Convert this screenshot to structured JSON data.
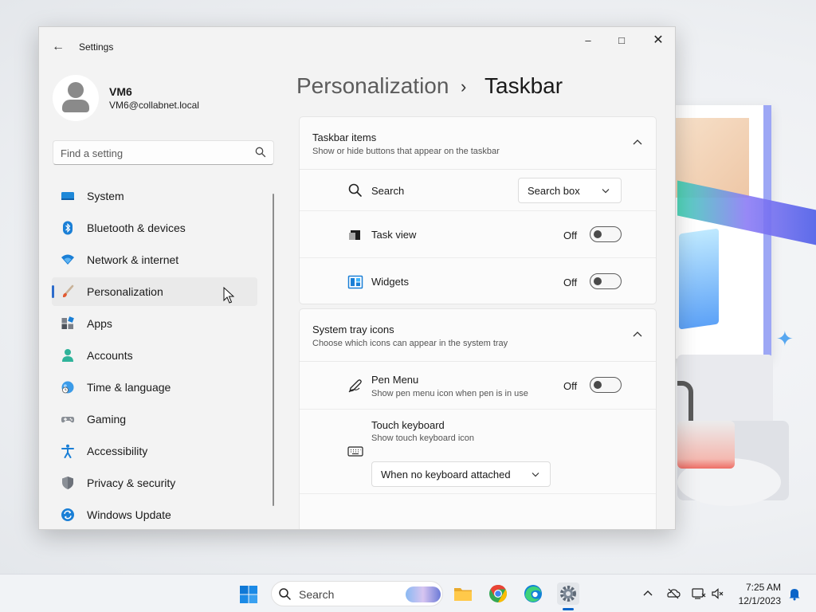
{
  "window": {
    "title": "Settings",
    "back_label": "←",
    "minimize_label": "–",
    "maximize_label": "□",
    "close_label": "✕"
  },
  "user": {
    "name": "VM6",
    "email": "VM6@collabnet.local"
  },
  "search": {
    "placeholder": "Find a setting",
    "value": ""
  },
  "sidebar": {
    "items": [
      {
        "label": "System",
        "icon": "monitor-icon"
      },
      {
        "label": "Bluetooth & devices",
        "icon": "bluetooth-icon"
      },
      {
        "label": "Network & internet",
        "icon": "wifi-icon"
      },
      {
        "label": "Personalization",
        "icon": "brush-icon",
        "selected": true
      },
      {
        "label": "Apps",
        "icon": "apps-icon"
      },
      {
        "label": "Accounts",
        "icon": "person-icon"
      },
      {
        "label": "Time & language",
        "icon": "globe-clock-icon"
      },
      {
        "label": "Gaming",
        "icon": "gamepad-icon"
      },
      {
        "label": "Accessibility",
        "icon": "accessibility-icon"
      },
      {
        "label": "Privacy & security",
        "icon": "shield-icon"
      },
      {
        "label": "Windows Update",
        "icon": "update-icon"
      }
    ]
  },
  "breadcrumb": {
    "parent": "Personalization",
    "separator": "›",
    "current": "Taskbar"
  },
  "taskbar_items": {
    "title": "Taskbar items",
    "subtitle": "Show or hide buttons that appear on the taskbar",
    "search": {
      "label": "Search",
      "value": "Search box"
    },
    "task_view": {
      "label": "Task view",
      "state": "Off"
    },
    "widgets": {
      "label": "Widgets",
      "state": "Off"
    }
  },
  "tray_icons": {
    "title": "System tray icons",
    "subtitle": "Choose which icons can appear in the system tray",
    "pen_menu": {
      "label": "Pen Menu",
      "description": "Show pen menu icon when pen is in use",
      "state": "Off"
    },
    "touch_keyboard": {
      "label": "Touch keyboard",
      "description": "Show touch keyboard icon",
      "value": "When no keyboard attached"
    }
  },
  "os_taskbar": {
    "search_label": "Search",
    "time": "7:25 AM",
    "date": "12/1/2023"
  },
  "colors": {
    "accent": "#2d6ccb",
    "toggle_knob": "#4a4a4a"
  }
}
